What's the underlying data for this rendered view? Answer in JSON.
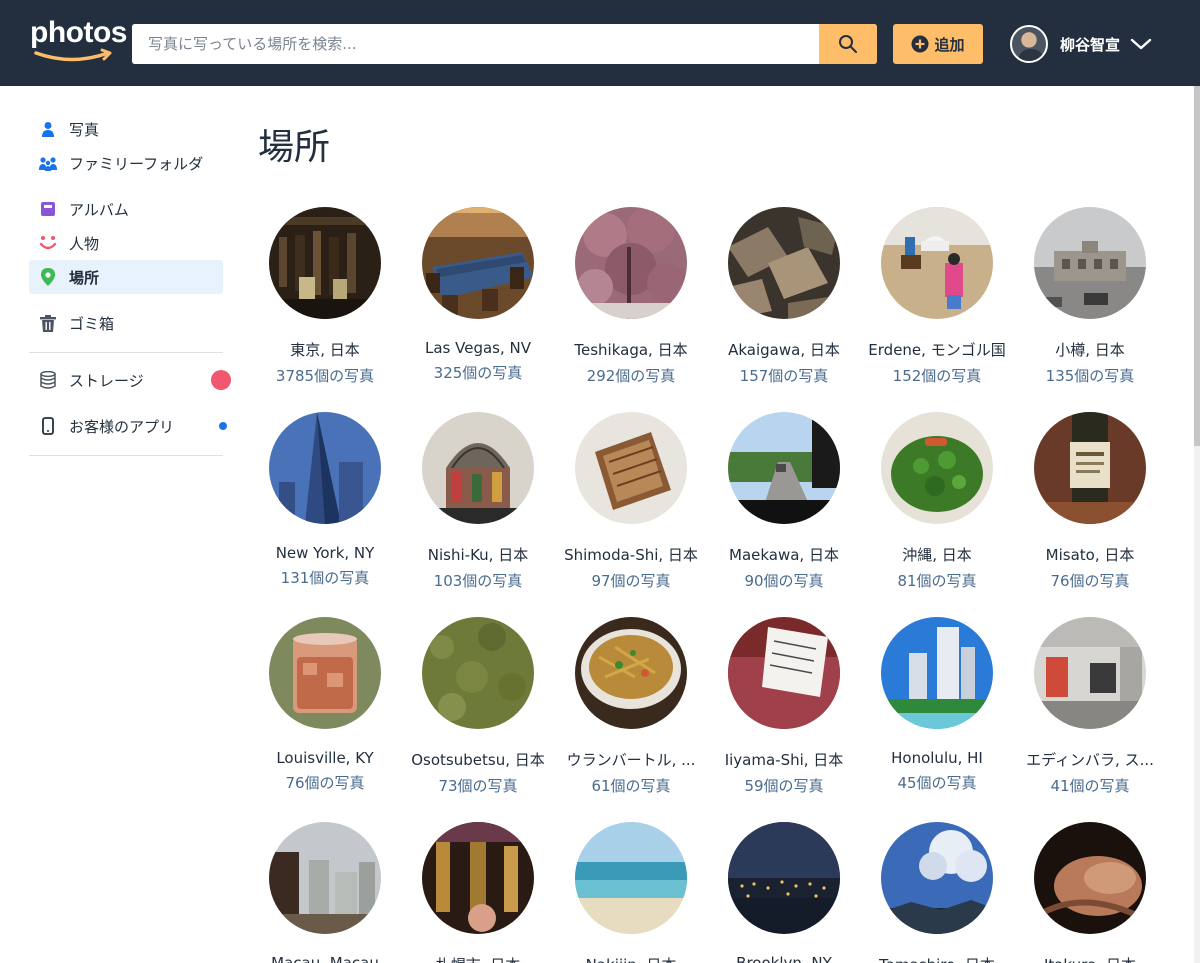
{
  "header": {
    "logo_text": "photos",
    "search_placeholder": "写真に写っている場所を検索...",
    "add_label": "追加",
    "user_name": "柳谷智宣"
  },
  "sidebar": {
    "items": [
      {
        "label": "写真",
        "icon": "person-icon"
      },
      {
        "label": "ファミリーフォルダ",
        "icon": "family-icon"
      },
      {
        "label": "アルバム",
        "icon": "album-icon"
      },
      {
        "label": "人物",
        "icon": "smile-icon"
      },
      {
        "label": "場所",
        "icon": "location-pin-icon"
      },
      {
        "label": "ゴミ箱",
        "icon": "trash-icon"
      },
      {
        "label": "ストレージ",
        "icon": "storage-icon"
      },
      {
        "label": "お客様のアプリ",
        "icon": "phone-icon"
      }
    ]
  },
  "main": {
    "title": "場所",
    "places": [
      {
        "name": "東京, 日本",
        "count": "3785個の写真"
      },
      {
        "name": "Las Vegas, NV",
        "count": "325個の写真"
      },
      {
        "name": "Teshikaga, 日本",
        "count": "292個の写真"
      },
      {
        "name": "Akaigawa, 日本",
        "count": "157個の写真"
      },
      {
        "name": "Erdene, モンゴル国",
        "count": "152個の写真"
      },
      {
        "name": "小樽, 日本",
        "count": "135個の写真"
      },
      {
        "name": "New York, NY",
        "count": "131個の写真"
      },
      {
        "name": "Nishi-Ku, 日本",
        "count": "103個の写真"
      },
      {
        "name": "Shimoda-Shi, 日本",
        "count": "97個の写真"
      },
      {
        "name": "Maekawa, 日本",
        "count": "90個の写真"
      },
      {
        "name": "沖縄, 日本",
        "count": "81個の写真"
      },
      {
        "name": "Misato, 日本",
        "count": "76個の写真"
      },
      {
        "name": "Louisville, KY",
        "count": "76個の写真"
      },
      {
        "name": "Osotsubetsu, 日本",
        "count": "73個の写真"
      },
      {
        "name": "ウランバートル, ...",
        "count": "61個の写真"
      },
      {
        "name": "Iiyama-Shi, 日本",
        "count": "59個の写真"
      },
      {
        "name": "Honolulu, HI",
        "count": "45個の写真"
      },
      {
        "name": "エディンバラ, ス...",
        "count": "41個の写真"
      },
      {
        "name": "Macau, Macau",
        "count": ""
      },
      {
        "name": "札幌市, 日本",
        "count": ""
      },
      {
        "name": "Nakijin, 日本",
        "count": ""
      },
      {
        "name": "Brooklyn, NY",
        "count": ""
      },
      {
        "name": "Tamashiro, 日本",
        "count": ""
      },
      {
        "name": "Itakura, 日本",
        "count": ""
      }
    ]
  },
  "colors": {
    "header_bg": "#232f3e",
    "accent": "#febd69",
    "active_bg": "#e8f2fd",
    "count_text": "#4a6b8f",
    "storage_badge": "#f0586f",
    "app_badge": "#1a73e8"
  }
}
